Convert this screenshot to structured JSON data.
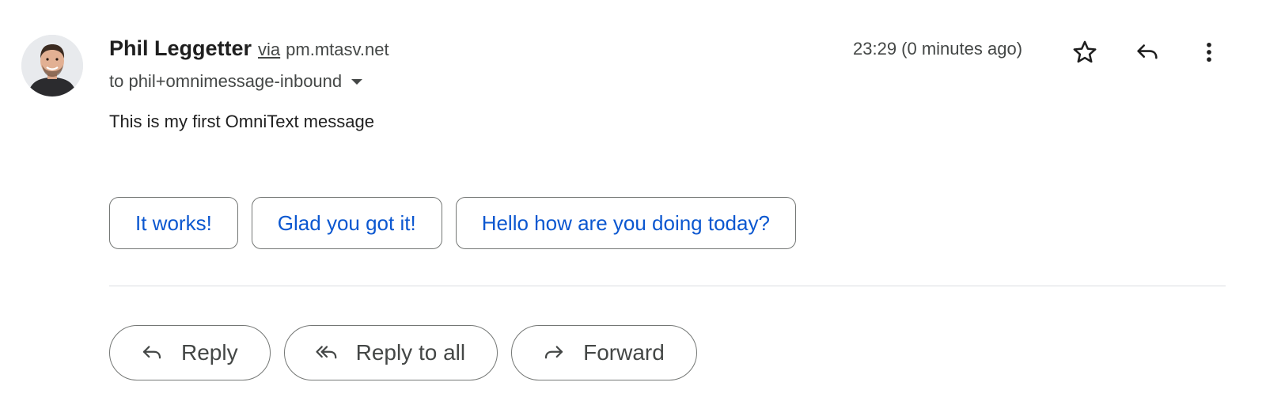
{
  "message": {
    "sender_name": "Phil Leggetter",
    "via_label": "via",
    "via_domain": "pm.mtasv.net",
    "recipient": "to phil+omnimessage-inbound",
    "timestamp": "23:29 (0 minutes ago)",
    "body": "This is my first OmniText message"
  },
  "header_icons": {
    "star": "star-icon",
    "reply": "reply-icon",
    "more": "more-vert-icon"
  },
  "smart_replies": [
    "It works!",
    "Glad you got it!",
    "Hello how are you doing today?"
  ],
  "actions": {
    "reply_label": "Reply",
    "reply_all_label": "Reply to all",
    "forward_label": "Forward"
  },
  "colors": {
    "accent": "#0b57d0",
    "text_primary": "#1f1f1f",
    "text_secondary": "#444746",
    "border": "#747775",
    "divider": "#dadce0"
  }
}
